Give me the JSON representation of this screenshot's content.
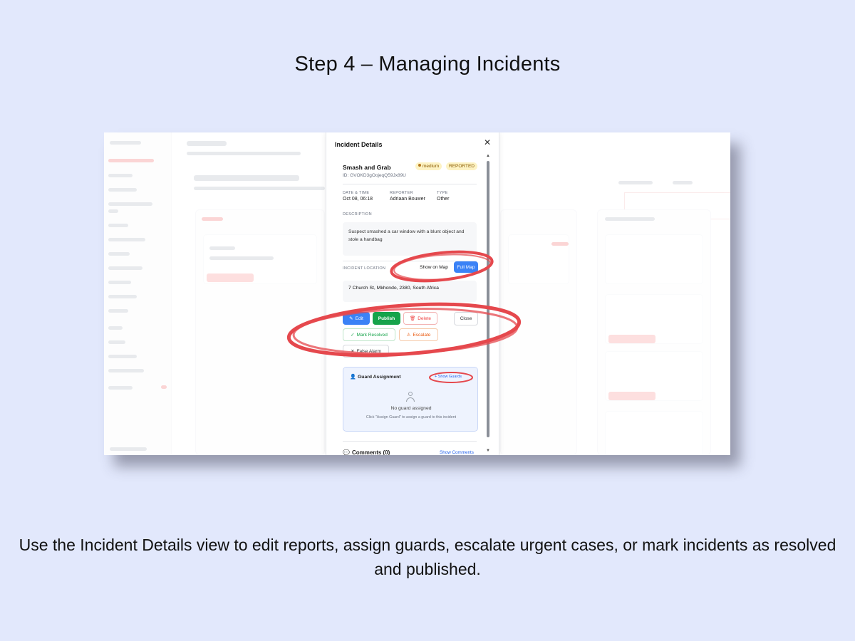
{
  "step_title": "Step 4 – Managing Incidents",
  "caption": "Use the Incident Details view to edit reports, assign guards, escalate urgent cases, or mark incidents as resolved and published.",
  "modal": {
    "title": "Incident Details",
    "close_icon": "close-icon",
    "incident": {
      "name": "Smash and Grab",
      "severity": "medium",
      "status": "REPORTED",
      "id": "ID: GVOKD3gOojeqQ59Jx89U"
    },
    "meta": {
      "date_label": "DATE & TIME",
      "date_value": "Oct 08, 06:18",
      "reporter_label": "REPORTER",
      "reporter_value": "Adriaan Bouwer",
      "type_label": "TYPE",
      "type_value": "Other"
    },
    "description": {
      "label": "DESCRIPTION",
      "text": "Suspect smashed a car window with a blunt object and stole a handbag"
    },
    "location": {
      "label": "INCIDENT LOCATION",
      "show_on_map": "Show on Map",
      "full_map": "Full Map",
      "address": "7 Church St, Mkhondo, 2380, South Africa"
    },
    "actions": {
      "edit": "Edit",
      "publish": "Publish",
      "delete": "Delete",
      "close": "Close",
      "mark_resolved": "Mark Resolved",
      "escalate": "Escalate",
      "false_alarm": "False Alarm"
    },
    "guard": {
      "title": "Guard Assignment",
      "show_guards": "+ Show Guards",
      "empty": "No guard assigned",
      "hint": "Click \"Assign Guard\" to assign a guard to this incident"
    },
    "comments": {
      "title": "Comments (0)",
      "show": "Show Comments"
    }
  },
  "colors": {
    "page_background": "#e2e8fc",
    "primary_blue": "#3b82f6",
    "publish_green": "#16a34a",
    "delete_red": "#ef4444",
    "escalate_orange": "#ea580c",
    "annotation_red": "#e5484d"
  }
}
